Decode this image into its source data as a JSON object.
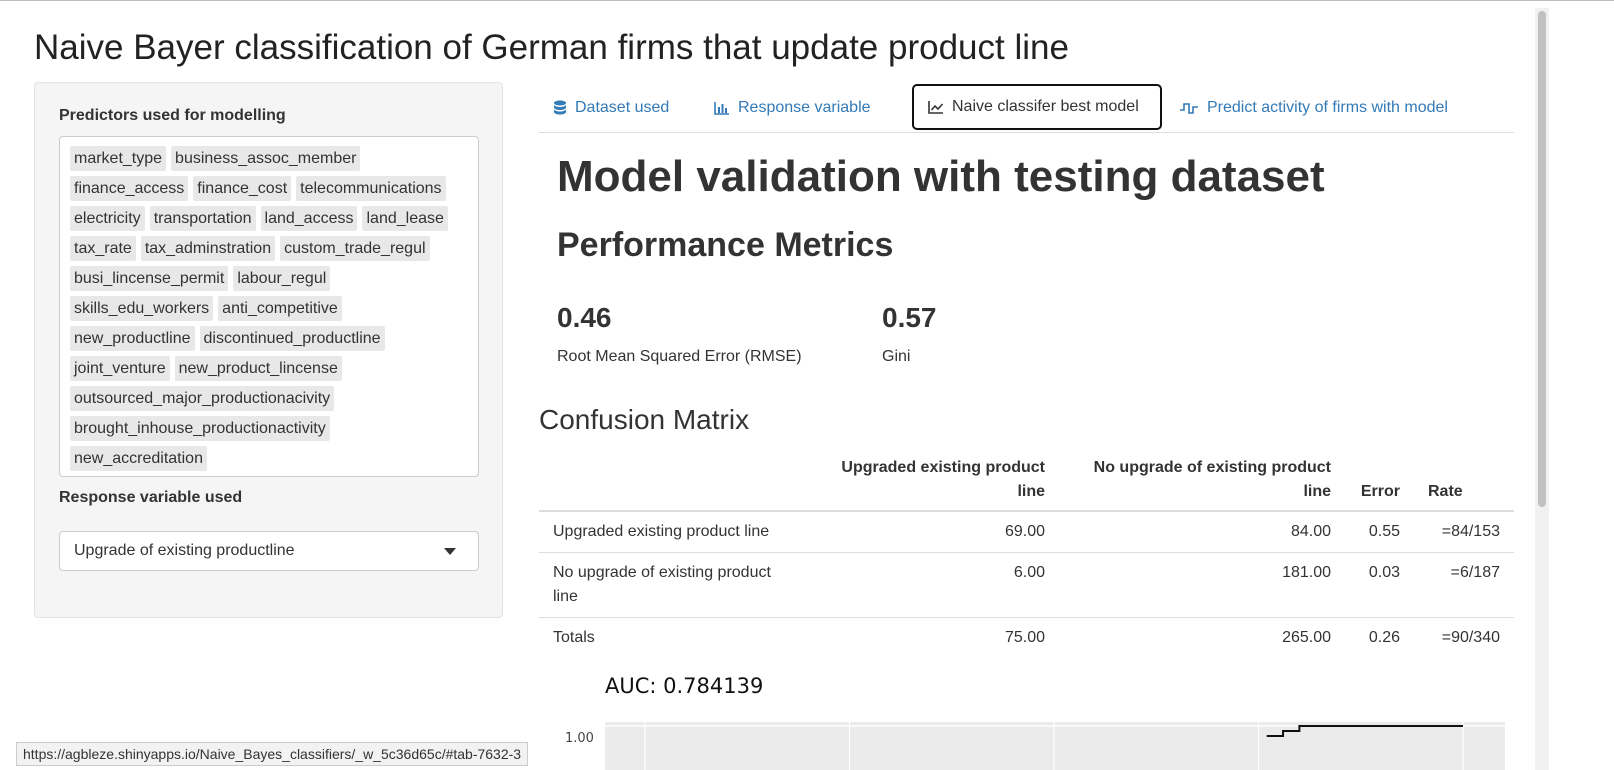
{
  "app_title": "Naive Bayer classification of German firms that update product line",
  "sidebar": {
    "predictors_label": "Predictors used for modelling",
    "predictor_rows": [
      [
        "market_type",
        "business_assoc_member"
      ],
      [
        "finance_access",
        "finance_cost",
        "telecommunications"
      ],
      [
        "electricity",
        "transportation",
        "land_access",
        "land_lease"
      ],
      [
        "tax_rate",
        "tax_adminstration",
        "custom_trade_regul"
      ],
      [
        "busi_lincense_permit",
        "labour_regul"
      ],
      [
        "skills_edu_workers",
        "anti_competitive"
      ],
      [
        "new_productline",
        "discontinued_productline"
      ],
      [
        "joint_venture",
        "new_product_lincense"
      ],
      [
        "outsourced_major_productionacivity"
      ],
      [
        "brought_inhouse_productionactivity"
      ],
      [
        "new_accreditation"
      ]
    ],
    "response_label": "Response variable used",
    "response_selected": "Upgrade of existing productline"
  },
  "tabs": [
    {
      "label": "Dataset used",
      "icon": "database-icon"
    },
    {
      "label": "Response variable",
      "icon": "bar-chart-icon"
    },
    {
      "label": "Naive classifer best model",
      "icon": "line-chart-icon"
    },
    {
      "label": "Predict activity of firms with model",
      "icon": "step-wave-icon"
    }
  ],
  "main": {
    "heading": "Model validation with testing dataset",
    "metrics_heading": "Performance Metrics",
    "metrics": [
      {
        "value": "0.46",
        "label": "Root Mean Squared Error (RMSE)"
      },
      {
        "value": "0.57",
        "label": "Gini"
      }
    ],
    "confusion_heading": "Confusion Matrix",
    "confusion": {
      "headers": [
        "",
        "Upgraded existing product line",
        "No upgrade of existing product line",
        "Error",
        "Rate"
      ],
      "rows": [
        [
          "Upgraded existing product line",
          "69.00",
          "84.00",
          "0.55",
          "=84/153"
        ],
        [
          "No upgrade of existing product line",
          "6.00",
          "181.00",
          "0.03",
          "=6/187"
        ],
        [
          "Totals",
          "75.00",
          "265.00",
          "0.26",
          "=90/340"
        ]
      ]
    },
    "auc_text": "AUC: 0.784139"
  },
  "chart_data": {
    "type": "line",
    "title": "AUC: 0.784139",
    "y_visible_tick": "1.00",
    "ylim": [
      0,
      1
    ],
    "series": [
      {
        "x": [
          0.76,
          0.78,
          0.78,
          0.8,
          0.8,
          0.86,
          0.86,
          0.94,
          0.94,
          1.0
        ],
        "y": [
          0.98,
          0.98,
          0.99,
          0.99,
          1.0,
          1.0,
          1.0,
          1.0,
          1.0,
          1.0
        ]
      }
    ],
    "grid": true
  },
  "status_url": "https://agbleze.shinyapps.io/Naive_Bayes_classifiers/_w_5c36d65c/#tab-7632-3",
  "colors": {
    "link": "#337ab7",
    "panel": "#f5f5f5",
    "chip": "#e8e8e8"
  }
}
